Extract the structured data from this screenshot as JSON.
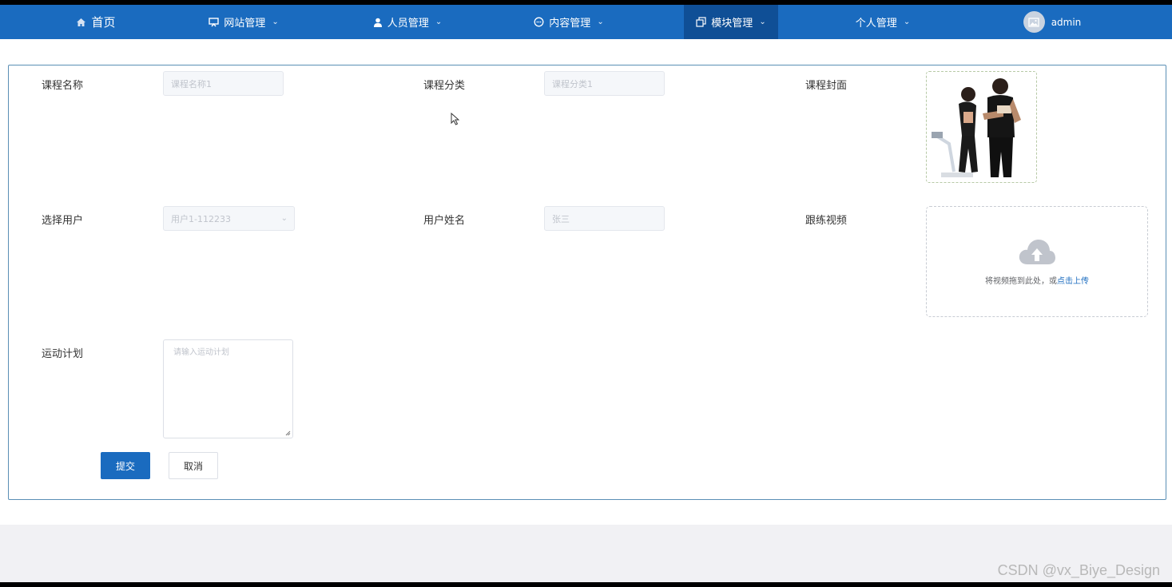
{
  "nav": {
    "home": "首页",
    "site_mgmt": "网站管理",
    "user_mgmt": "人员管理",
    "content_mgmt": "内容管理",
    "module_mgmt": "模块管理",
    "personal_mgmt": "个人管理",
    "admin": "admin"
  },
  "form": {
    "course_name": {
      "label": "课程名称",
      "placeholder": "课程名称1"
    },
    "course_category": {
      "label": "课程分类",
      "placeholder": "课程分类1"
    },
    "course_cover": {
      "label": "课程封面"
    },
    "select_user": {
      "label": "选择用户",
      "value": "用户1-112233"
    },
    "user_name": {
      "label": "用户姓名",
      "placeholder": "张三"
    },
    "video": {
      "label": "跟练视频",
      "hint": "将视频拖到此处，或",
      "link": "点击上传"
    },
    "plan": {
      "label": "运动计划",
      "placeholder": "请输入运动计划"
    },
    "submit": "提交",
    "cancel": "取消"
  },
  "watermark": "CSDN @vx_Biye_Design",
  "colors": {
    "nav_bg": "#1a6bbf",
    "nav_active": "#0f4f96",
    "primary": "#1a6bbf",
    "card_border": "#5a8fb5"
  }
}
